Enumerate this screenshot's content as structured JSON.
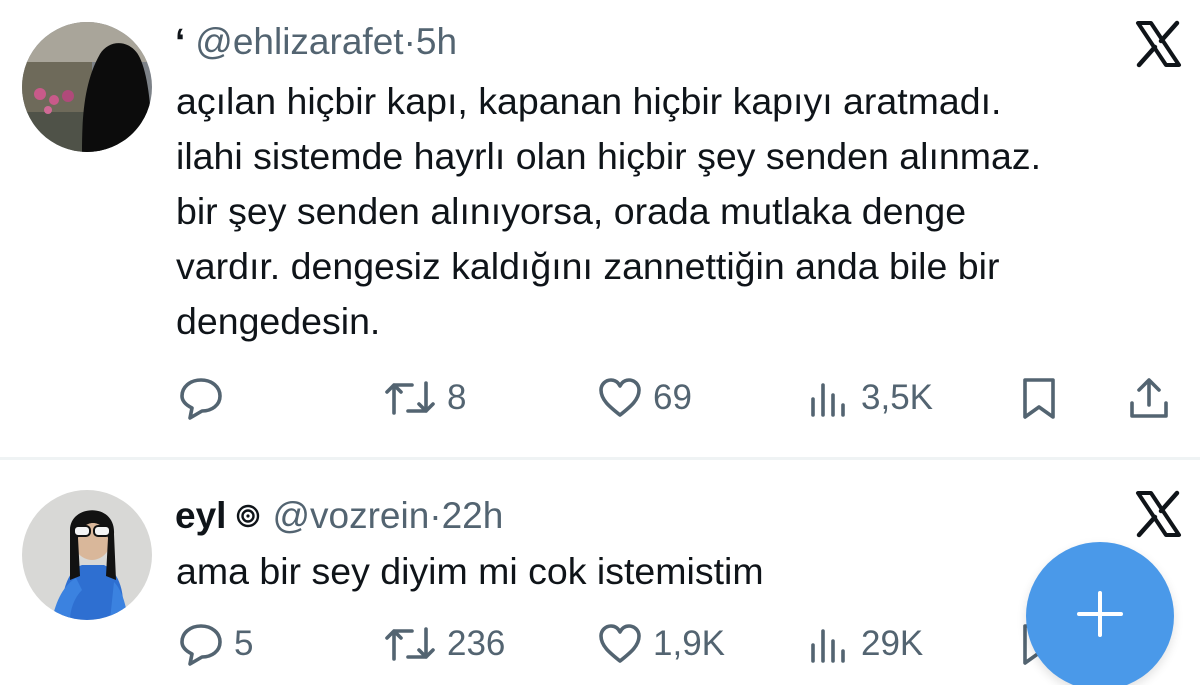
{
  "tweets": [
    {
      "handle": "@ehlizarafet",
      "name_prefix": "‘",
      "separator": "·",
      "time": "5h",
      "body_lines": [
        "açılan hiçbir kapı, kapanan hiçbir kapıyı aratmadı.",
        "ilahi sistemde hayrlı olan hiçbir şey senden alınmaz.",
        "bir şey senden alınıyorsa, orada mutlaka denge",
        "vardır. dengesiz kaldığını zannettiğin anda bile bir",
        "dengedesin."
      ],
      "actions": {
        "reply_count": "",
        "retweet_count": "8",
        "like_count": "69",
        "views_count": "3,5K"
      }
    },
    {
      "name": "eyl",
      "handle": "@vozrein",
      "separator": "·",
      "time": "22h",
      "body_lines": [
        "ama bir sey diyim mi cok istemistim"
      ],
      "actions": {
        "reply_count": "5",
        "retweet_count": "236",
        "like_count": "1,9K",
        "views_count": "29K"
      }
    }
  ],
  "colors": {
    "text_primary": "#0f1419",
    "text_secondary": "#536471",
    "divider": "#eff3f4",
    "fab_blue": "#4a99e9"
  },
  "icons": {
    "close": "x-logo-icon",
    "reply": "reply-bubble-icon",
    "retweet": "retweet-icon",
    "like": "heart-icon",
    "views": "bar-chart-icon",
    "bookmark": "bookmark-icon",
    "share": "share-upload-icon",
    "compose": "plus-icon",
    "badge": "spiral-badge-icon"
  }
}
